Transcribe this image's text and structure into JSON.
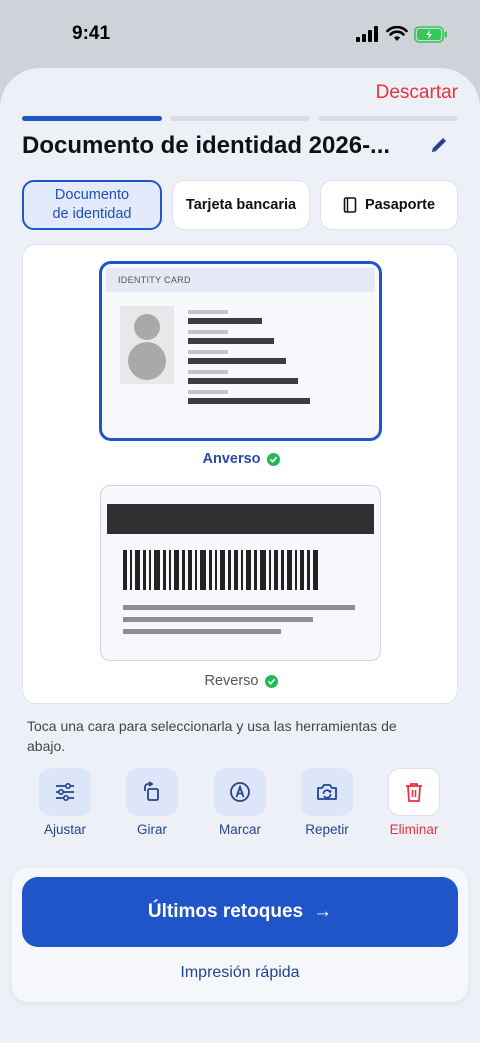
{
  "status": {
    "time": "9:41"
  },
  "header": {
    "discard_label": "Descartar",
    "title": "Documento de identidad 2026-..."
  },
  "tabs": [
    {
      "line1": "Documento",
      "line2": "de identidad",
      "selected": true
    },
    {
      "label": "Tarjeta bancaria"
    },
    {
      "label": "Pasaporte",
      "icon": "book-icon"
    }
  ],
  "card": {
    "front_header": "IDENTITY CARD",
    "front_label": "Anverso",
    "back_label": "Reverso"
  },
  "hint": "Toca una cara para seleccionarla y usa las herramientas de abajo.",
  "tools": [
    {
      "label": "Ajustar",
      "icon": "sliders-icon"
    },
    {
      "label": "Girar",
      "icon": "rotate-icon"
    },
    {
      "label": "Marcar",
      "icon": "markup-icon"
    },
    {
      "label": "Repetir",
      "icon": "retake-camera-icon"
    },
    {
      "label": "Eliminar",
      "icon": "trash-icon"
    }
  ],
  "cta": {
    "primary": "Últimos retoques",
    "arrow": "→",
    "secondary": "Impresión rápida"
  },
  "colors": {
    "accent": "#1f55c8",
    "danger": "#e5343a",
    "success": "#22b957"
  }
}
